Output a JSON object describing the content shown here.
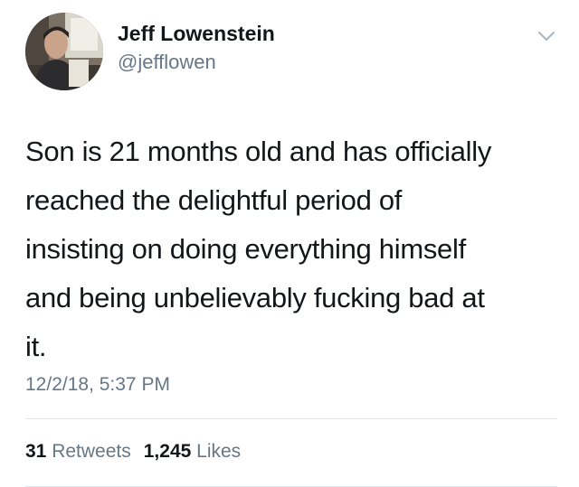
{
  "tweet": {
    "author": {
      "name": "Jeff Lowenstein",
      "handle": "@jefflowen"
    },
    "lines": [
      "Son is 21 months old and has officially",
      "reached the delightful period of",
      "insisting on doing everything himself",
      "and being unbelievably fucking bad at",
      "it."
    ],
    "timestamp": "12/2/18, 5:37 PM",
    "stats": {
      "retweets_count": "31",
      "retweets_label": "Retweets",
      "likes_count": "1,245",
      "likes_label": "Likes"
    }
  },
  "icons": {
    "menu": "chevron-down-icon"
  },
  "colors": {
    "text": "#14171a",
    "secondary": "#657786",
    "divider": "#e1e8ed"
  }
}
